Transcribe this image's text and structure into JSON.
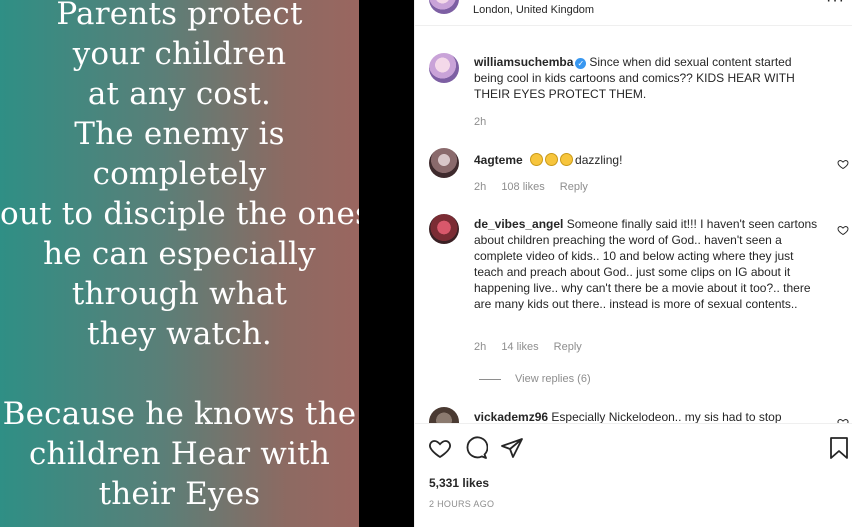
{
  "post_image": {
    "lines_top": [
      "Parents protect",
      "your children",
      "at any cost.",
      "The enemy is",
      "completely",
      "out to disciple the ones",
      "he can especially",
      "through what",
      "they watch."
    ],
    "lines_bottom": [
      "Because he knows the",
      "children Hear with",
      "their Eyes"
    ]
  },
  "header": {
    "location": "London, United Kingdom",
    "more_label": "···"
  },
  "caption": {
    "username": "williamsuchemba",
    "verified_icon": "check-icon",
    "text": "Since when did sexual content started being cool in kids cartoons and comics?? KIDS HEAR WITH THEIR EYES PROTECT THEM.",
    "time": "2h"
  },
  "comments": [
    {
      "username": "4agteme",
      "emoji_icon": "smiling-face-emoji",
      "text": "dazzling!",
      "time": "2h",
      "likes": "108 likes",
      "reply_label": "Reply"
    },
    {
      "username": "de_vibes_angel",
      "text": "Someone finally said it!!! I haven't seen cartons about children preaching the word of God.. haven't seen a complete video of kids.. 10 and below acting where they just teach and preach about God.. just some clips on IG about it happening live.. why can't there be a movie about it too?.. there are many kids out there.. instead is more of sexual contents..",
      "time": "2h",
      "likes": "14 likes",
      "reply_label": "Reply",
      "view_replies": "View replies (6)"
    },
    {
      "username": "vickademz96",
      "text": "Especially Nickelodeon.. my sis had to stop"
    }
  ],
  "actions": {
    "likes": "5,331 likes",
    "time_ago": "2 HOURS AGO"
  }
}
